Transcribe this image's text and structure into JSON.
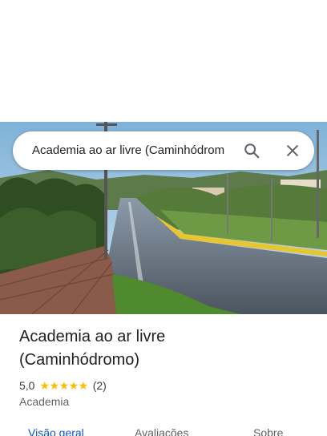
{
  "search": {
    "query": "Academia ao ar livre (Caminhódrom"
  },
  "place": {
    "name_line1": "Academia ao ar livre",
    "name_line2": "(Caminhódromo)",
    "rating": "5,0",
    "stars": "★★★★★",
    "review_count": "(2)",
    "category": "Academia"
  },
  "tabs": [
    {
      "label": "Visão geral",
      "active": true
    },
    {
      "label": "Avaliações",
      "active": false
    },
    {
      "label": "Sobre",
      "active": false
    }
  ],
  "icons": {
    "search": "search-icon",
    "close": "close-icon"
  },
  "colors": {
    "accent": "#0b57d0",
    "star": "#fbbc04",
    "text_primary": "#202124",
    "text_secondary": "#5f6368"
  }
}
